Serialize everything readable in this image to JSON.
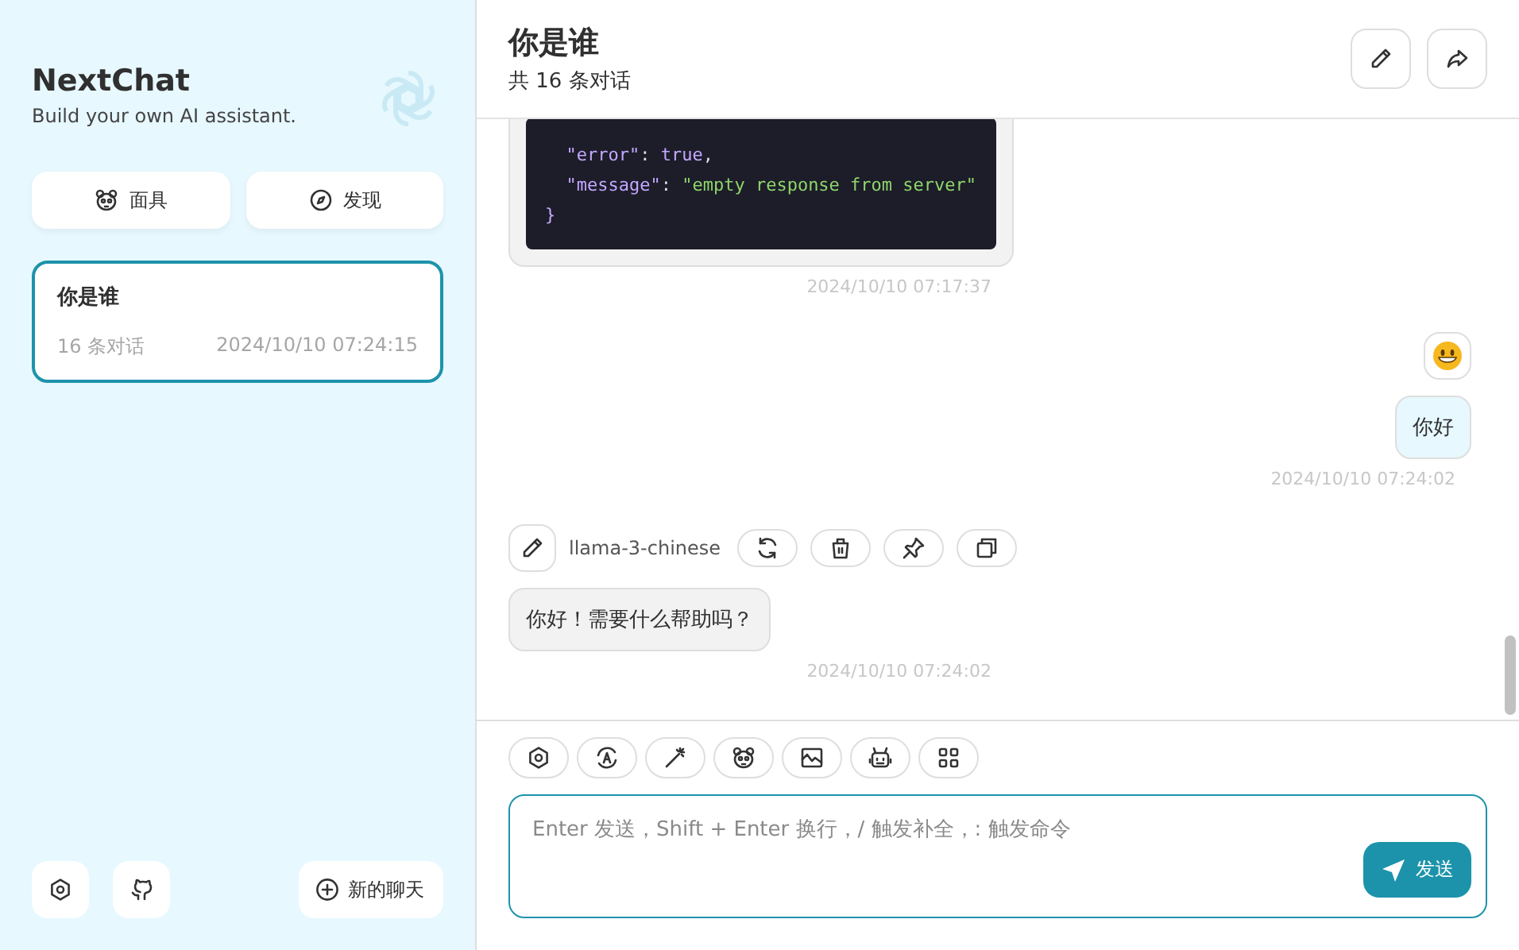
{
  "sidebar": {
    "title": "NextChat",
    "subtitle": "Build your own AI assistant.",
    "actions": [
      {
        "kind": "mask",
        "label": "面具"
      },
      {
        "kind": "discover",
        "label": "发现"
      }
    ],
    "chats": [
      {
        "title": "你是谁",
        "count": "16 条对话",
        "time": "2024/10/10 07:24:15",
        "selected": true
      }
    ],
    "bottom": {
      "tools": [
        {
          "kind": "settings"
        },
        {
          "kind": "github"
        }
      ],
      "new_chat": "新的聊天"
    }
  },
  "header": {
    "title": "你是谁",
    "subtitle": "共 16 条对话",
    "actions": [
      {
        "kind": "edit"
      },
      {
        "kind": "share"
      }
    ]
  },
  "messages": [
    {
      "from_user": false,
      "kind": "code",
      "lines": [
        {
          "indented": true,
          "tokens": [
            {
              "kind": "key",
              "t": "\"error\""
            },
            {
              "kind": "plain",
              "t": ": "
            },
            {
              "kind": "bool",
              "t": "true"
            },
            {
              "kind": "plain",
              "t": ","
            }
          ]
        },
        {
          "indented": true,
          "tokens": [
            {
              "kind": "key",
              "t": "\"message\""
            },
            {
              "kind": "plain",
              "t": ": "
            },
            {
              "kind": "str",
              "t": "\"empty response from server\""
            }
          ]
        },
        {
          "indented": false,
          "tokens": [
            {
              "kind": "key",
              "t": "}"
            }
          ]
        }
      ],
      "time": "2024/10/10 07:17:37"
    },
    {
      "from_user": true,
      "kind": "text",
      "text": "你好",
      "time": "2024/10/10 07:24:02"
    },
    {
      "from_user": false,
      "kind": "text",
      "model": "llama-3-chinese",
      "actions": [
        {
          "kind": "retry"
        },
        {
          "kind": "delete"
        },
        {
          "kind": "pin"
        },
        {
          "kind": "copy"
        }
      ],
      "text": "你好！需要什么帮助吗？",
      "time": "2024/10/10 07:24:02"
    }
  ],
  "input": {
    "tools": [
      {
        "kind": "settings"
      },
      {
        "kind": "translate"
      },
      {
        "kind": "magic"
      },
      {
        "kind": "mask"
      },
      {
        "kind": "image"
      },
      {
        "kind": "robot"
      },
      {
        "kind": "grid"
      }
    ],
    "placeholder": "Enter 发送，Shift + Enter 换行，/ 触发补全，: 触发命令",
    "send": "发送"
  }
}
